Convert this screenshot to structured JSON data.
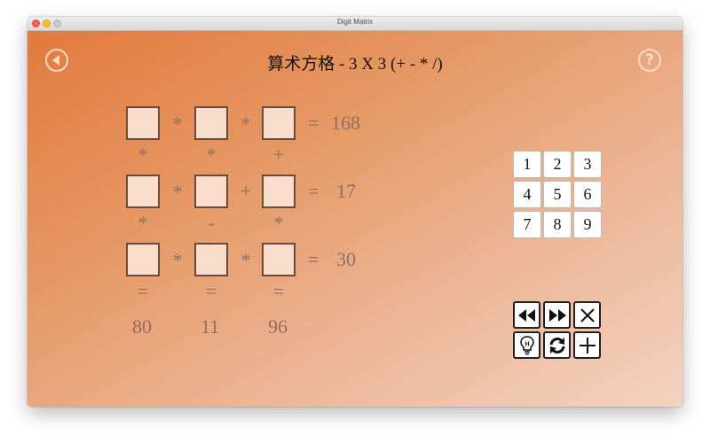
{
  "window": {
    "title": "Digit Matrix"
  },
  "header": {
    "title": "算术方格 - 3 X 3 (+ - * /)",
    "help_label": "?"
  },
  "puzzle": {
    "rows": [
      {
        "ops": [
          "*",
          "*"
        ],
        "equals": "=",
        "result": "168"
      },
      {
        "ops": [
          "*",
          "+"
        ],
        "equals": "=",
        "result": "17"
      },
      {
        "ops": [
          "*",
          "*"
        ],
        "equals": "=",
        "result": "30"
      }
    ],
    "col_ops": [
      [
        "*",
        "*",
        "+"
      ],
      [
        "*",
        "-",
        "*"
      ]
    ],
    "col_equals": [
      "=",
      "=",
      "="
    ],
    "col_results": [
      "80",
      "11",
      "96"
    ]
  },
  "keypad": {
    "keys": [
      "1",
      "2",
      "3",
      "4",
      "5",
      "6",
      "7",
      "8",
      "9"
    ]
  },
  "controls": {
    "buttons": [
      {
        "name": "rewind-button",
        "icon": "rewind-icon"
      },
      {
        "name": "fast-forward-button",
        "icon": "fast-forward-icon"
      },
      {
        "name": "clear-button",
        "icon": "close-icon"
      },
      {
        "name": "hint-button",
        "icon": "lightbulb-icon",
        "icon_text": "H"
      },
      {
        "name": "restart-button",
        "icon": "refresh-icon"
      },
      {
        "name": "new-puzzle-button",
        "icon": "plus-icon"
      }
    ]
  },
  "colors": {
    "gradient_start": "#e27a3d",
    "gradient_end": "#f3d3c1",
    "cell_fill": "#f8ddcd",
    "cell_border": "#6b4a3a",
    "operator_text": "#8e6f63"
  }
}
